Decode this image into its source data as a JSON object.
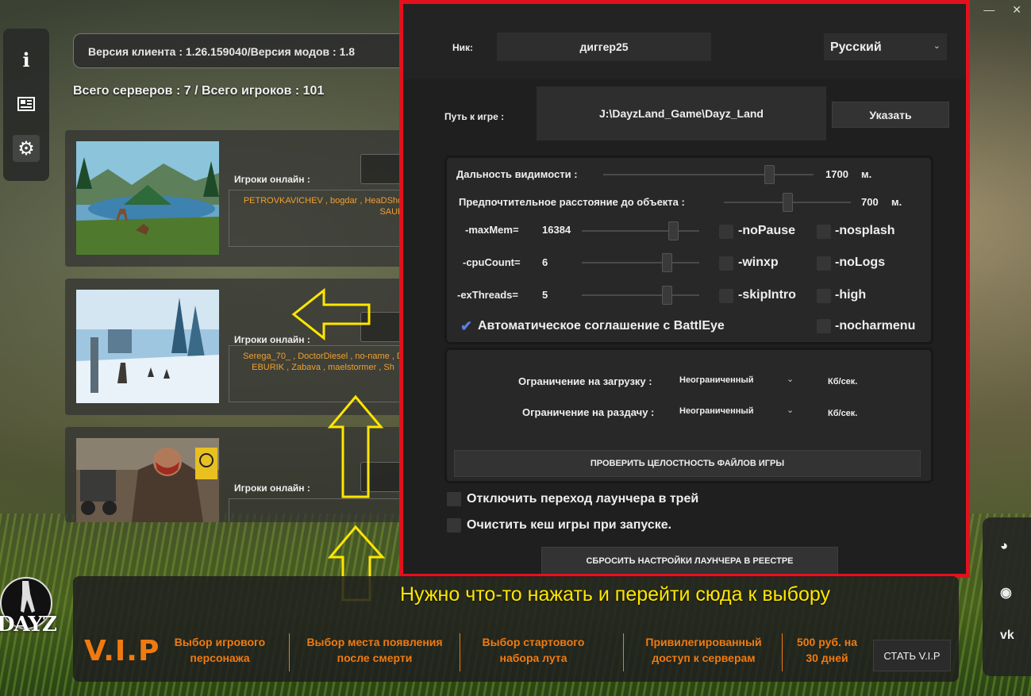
{
  "window": {
    "minimize": "—",
    "close": "✕"
  },
  "sidebar": {
    "items": [
      {
        "name": "info-icon",
        "glyph": "i"
      },
      {
        "name": "news-icon",
        "glyph": "▤"
      },
      {
        "name": "settings-icon",
        "glyph": "⚙"
      }
    ]
  },
  "header": {
    "version_text": "Версия клиента : 1.26.159040/Версия модов : 1.8",
    "totals_text": "Всего серверов : 7 / Всего игроков : 101"
  },
  "servers": [
    {
      "online_label": "Игроки онлайн :",
      "players_line1": "PETROVKAVICHEV , bogdar , HeaDSho",
      "players_line2": "SAUR"
    },
    {
      "online_label": "Игроки онлайн :",
      "players_line1": "Serega_70_ , DoctorDiesel , no-name , D",
      "players_line2": "EBURIK , Zabava , maelstormer , Sh"
    },
    {
      "online_label": "Игроки онлайн :",
      "players_line1": "",
      "players_line2": ""
    }
  ],
  "settings": {
    "nick_label": "Ник:",
    "nick_value": "диггер25",
    "language_value": "Русский",
    "path_label": "Путь к игре :",
    "path_value": "J:\\DayzLand_Game\\Dayz_Land",
    "path_button": "Указать",
    "view_distance_label": "Дальность видимости :",
    "view_distance_value": "1700",
    "view_distance_unit": "м.",
    "view_distance_level": 0.79,
    "object_distance_label": "Предпочтительное расстояние до объекта :",
    "object_distance_value": "700",
    "object_distance_unit": "м.",
    "object_distance_level": 0.5,
    "maxmem_label": "-maxMem=",
    "maxmem_value": "16384",
    "maxmem_level": 0.78,
    "cpucount_label": "-cpuCount=",
    "cpucount_value": "6",
    "cpucount_level": 0.72,
    "exthreads_label": "-exThreads=",
    "exthreads_value": "5",
    "exthreads_level": 0.72,
    "flags": [
      "-noPause",
      "-nosplash",
      "-winxp",
      "-noLogs",
      "-skipIntro",
      "-high",
      "-nocharmenu"
    ],
    "battleye_label": "Автоматическое соглашение с BattlEye",
    "battleye_checked": true,
    "download_label": "Ограничение на загрузку :",
    "download_value": "Неограниченный",
    "download_unit": "Кб/сек.",
    "upload_label": "Ограничение на раздачу :",
    "upload_value": "Неограниченный",
    "upload_unit": "Кб/сек.",
    "verify_button": "ПРОВЕРИТЬ ЦЕЛОСТНОСТЬ ФАЙЛОВ ИГРЫ",
    "tray_label": "Отключить переход лаунчера в трей",
    "cache_label": "Очистить кеш игры при запуске.",
    "reset_button": "СБРОСИТЬ НАСТРОЙКИ ЛАУНЧЕРА В РЕЕСТРЕ"
  },
  "annotation": {
    "hint_text": "Нужно что-то нажать и перейти сюда к выбору",
    "arrow_color": "#ffe600",
    "frame_color": "#e3111d"
  },
  "vip": {
    "logo_text": "V.I.P",
    "items": [
      {
        "line1": "Выбор игрового",
        "line2": "персонажа"
      },
      {
        "line1": "Выбор места появления",
        "line2": "после смерти"
      },
      {
        "line1": "Выбор стартового",
        "line2": "набора лута"
      },
      {
        "line1": "Привилегированный",
        "line2": "доступ к серверам"
      },
      {
        "line1": "500 руб. на",
        "line2": "30 дней"
      }
    ],
    "button": "СТАТЬ V.I.P",
    "accent": "#f07a10"
  },
  "logo": {
    "text": "DAYZ"
  },
  "social": [
    {
      "name": "globe-icon",
      "glyph": "◕"
    },
    {
      "name": "discord-icon",
      "glyph": "◉"
    },
    {
      "name": "vk-icon",
      "glyph": "vk"
    }
  ]
}
